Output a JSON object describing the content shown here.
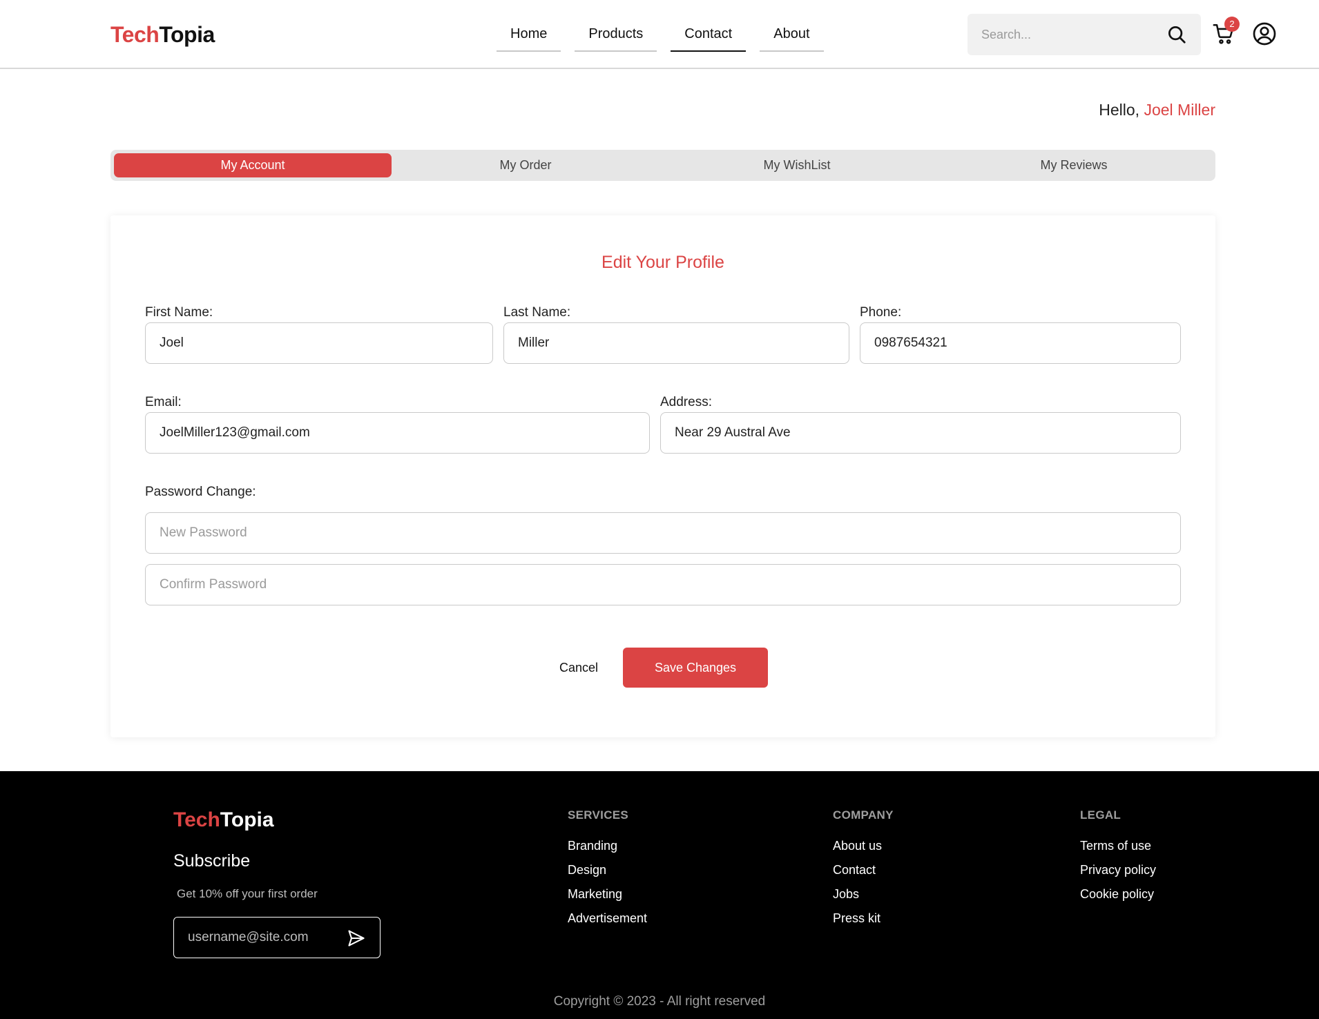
{
  "brand": {
    "part1": "Tech",
    "part2": "Topia",
    "accent_color": "#db4444"
  },
  "nav": {
    "items": [
      "Home",
      "Products",
      "Contact",
      "About"
    ],
    "active": "Contact"
  },
  "search": {
    "placeholder": "Search...",
    "icon": "search-icon"
  },
  "cart": {
    "count": "2",
    "icon": "cart-icon"
  },
  "user": {
    "icon": "user-circle-icon"
  },
  "greeting": {
    "prefix": "Hello, ",
    "name": "Joel Miller"
  },
  "tabs": [
    "My Account",
    "My Order",
    "My WishList",
    "My Reviews"
  ],
  "active_tab": "My Account",
  "profile": {
    "title": "Edit Your Profile",
    "first_name": {
      "label": "First Name:",
      "value": "Joel"
    },
    "last_name": {
      "label": "Last Name:",
      "value": "Miller"
    },
    "phone": {
      "label": "Phone:",
      "value": "0987654321"
    },
    "email": {
      "label": "Email:",
      "value": "JoelMiller123@gmail.com"
    },
    "address": {
      "label": "Address:",
      "value": "Near 29 Austral Ave"
    },
    "password": {
      "label": "Password Change:",
      "new_placeholder": "New Password",
      "confirm_placeholder": "Confirm Password"
    },
    "cancel_label": "Cancel",
    "save_label": "Save Changes"
  },
  "footer": {
    "brand": {
      "part1": "Tech",
      "part2": "Topia"
    },
    "subscribe_title": "Subscribe",
    "subscribe_offer": "Get 10% off your first order",
    "email_placeholder": "username@site.com",
    "send_icon": "send-icon",
    "services": {
      "title": "SERVICES",
      "links": [
        "Branding",
        "Design",
        "Marketing",
        "Advertisement"
      ]
    },
    "company": {
      "title": "COMPANY",
      "links": [
        "About us",
        "Contact",
        "Jobs",
        "Press kit"
      ]
    },
    "legal": {
      "title": "LEGAL",
      "links": [
        "Terms of use",
        "Privacy policy",
        "Cookie policy"
      ]
    },
    "copyright": "Copyright © 2023 - All right reserved"
  }
}
